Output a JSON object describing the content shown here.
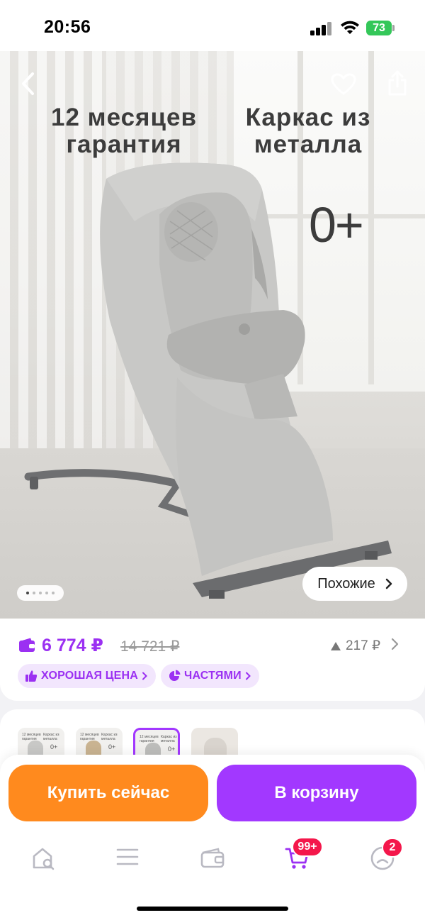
{
  "status_bar": {
    "time": "20:56",
    "battery": "73"
  },
  "hero": {
    "text_left": "12 месяцев\nгарантия",
    "text_right": "Каркас из\nметалла",
    "age": "0+",
    "similar_label": "Похожие",
    "slides_total": 5,
    "slide_active": 1
  },
  "price": {
    "current": "6 774 ₽",
    "old": "14 721 ₽",
    "delta": "217 ₽",
    "chips": [
      "ХОРОШАЯ ЦЕНА",
      "ЧАСТЯМИ"
    ]
  },
  "variants": [
    {
      "text_left": "12 месяцев\nгарантия",
      "text_right": "Каркас из\nметалла",
      "age": "0+",
      "color": "#c8c8c6",
      "selected": false
    },
    {
      "text_left": "12 месяцев\nгарантия",
      "text_right": "Каркас из\nметалла",
      "age": "0+",
      "color": "#c9b391",
      "selected": false
    },
    {
      "text_left": "12 месяцев\nгарантия",
      "text_right": "Каркас из\nметалла",
      "age": "0+",
      "color": "#bdbdbb",
      "selected": true
    },
    {
      "text_left": "",
      "text_right": "",
      "age": "",
      "color": "#d9d4ce",
      "selected": false
    }
  ],
  "actions": {
    "buy_now": "Купить сейчас",
    "add_to_cart": "В корзину"
  },
  "tabbar": {
    "cart_badge": "99+",
    "profile_badge": "2",
    "accent": "#9b30f2",
    "icons": [
      "home-search-icon",
      "catalog-icon",
      "wallet-icon",
      "cart-icon",
      "profile-icon"
    ]
  },
  "colors": {
    "purple": "#9b30f2",
    "orange": "#ff8a1e",
    "cart_button": "#a238ff",
    "badge_red": "#f4174b"
  }
}
